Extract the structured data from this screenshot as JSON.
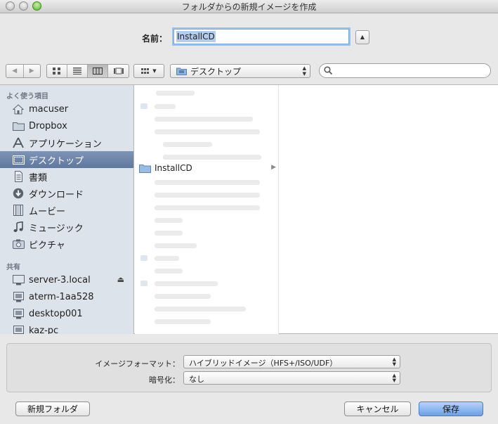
{
  "window": {
    "title": "フォルダからの新規イメージを作成"
  },
  "name_row": {
    "label": "名前：",
    "value": "InstallCD"
  },
  "toolbar": {
    "nav_back": "◀",
    "nav_forward": "▶",
    "location": "デスクトップ",
    "search_placeholder": ""
  },
  "sidebar": {
    "favorites_header": "よく使う項目",
    "favorites": [
      {
        "label": "macuser",
        "icon": "home-icon"
      },
      {
        "label": "Dropbox",
        "icon": "folder-icon"
      },
      {
        "label": "アプリケーション",
        "icon": "applications-icon"
      },
      {
        "label": "デスクトップ",
        "icon": "desktop-icon",
        "selected": true
      },
      {
        "label": "書類",
        "icon": "documents-icon"
      },
      {
        "label": "ダウンロード",
        "icon": "download-icon"
      },
      {
        "label": "ムービー",
        "icon": "movie-icon"
      },
      {
        "label": "ミュージック",
        "icon": "music-icon"
      },
      {
        "label": "ピクチャ",
        "icon": "camera-icon"
      }
    ],
    "shared_header": "共有",
    "shared": [
      {
        "label": "server-3.local",
        "icon": "monitor-icon"
      },
      {
        "label": "aterm-1aa528",
        "icon": "server-icon"
      },
      {
        "label": "desktop001",
        "icon": "server-icon"
      },
      {
        "label": "kaz-pc",
        "icon": "server-icon"
      }
    ]
  },
  "browser": {
    "column1": {
      "visible_item": "InstallCD"
    }
  },
  "options": {
    "format_label": "イメージフォーマット：",
    "format_value": "ハイブリッドイメージ（HFS+/ISO/UDF）",
    "encryption_label": "暗号化：",
    "encryption_value": "なし"
  },
  "buttons": {
    "new_folder": "新規フォルダ",
    "cancel": "キャンセル",
    "save": "保存"
  },
  "colors": {
    "sidebar_bg": "#dde3ea",
    "selection": "#6b82a8",
    "default_button": "#6aa1e6"
  }
}
